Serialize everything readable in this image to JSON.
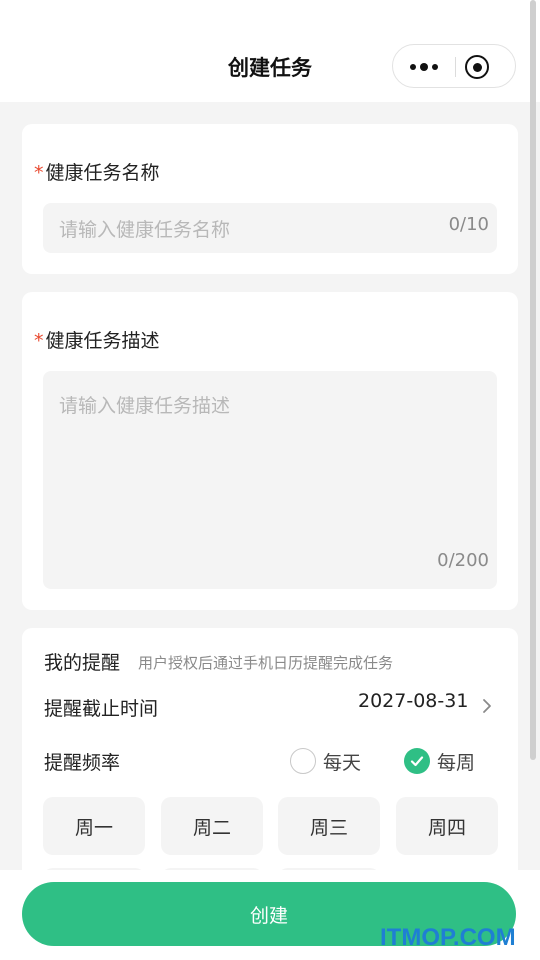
{
  "navbar": {
    "title": "创建任务"
  },
  "task_name": {
    "required_mark": "*",
    "label": "健康任务名称",
    "placeholder": "请输入健康任务名称",
    "counter": "0/10"
  },
  "task_desc": {
    "required_mark": "*",
    "label": "健康任务描述",
    "placeholder": "请输入健康任务描述",
    "counter": "0/200"
  },
  "reminder": {
    "title": "我的提醒",
    "subtitle": "用户授权后通过手机日历提醒完成任务",
    "deadline_label": "提醒截止时间",
    "deadline_value": "2027-08-31",
    "frequency_label": "提醒频率",
    "options": [
      {
        "label": "每天",
        "checked": false
      },
      {
        "label": "每周",
        "checked": true
      }
    ],
    "weekdays": [
      "周一",
      "周二",
      "周三",
      "周四"
    ]
  },
  "footer": {
    "create_label": "创建",
    "watermark": "ITMOP.COM"
  },
  "colors": {
    "accent": "#2fbf85",
    "required": "#e8492f",
    "watermark": "#1f7fd3"
  },
  "icons": {
    "more": "more-dots-icon",
    "close": "capsule-close-icon",
    "chevron": "chevron-right-icon",
    "check": "check-icon"
  }
}
